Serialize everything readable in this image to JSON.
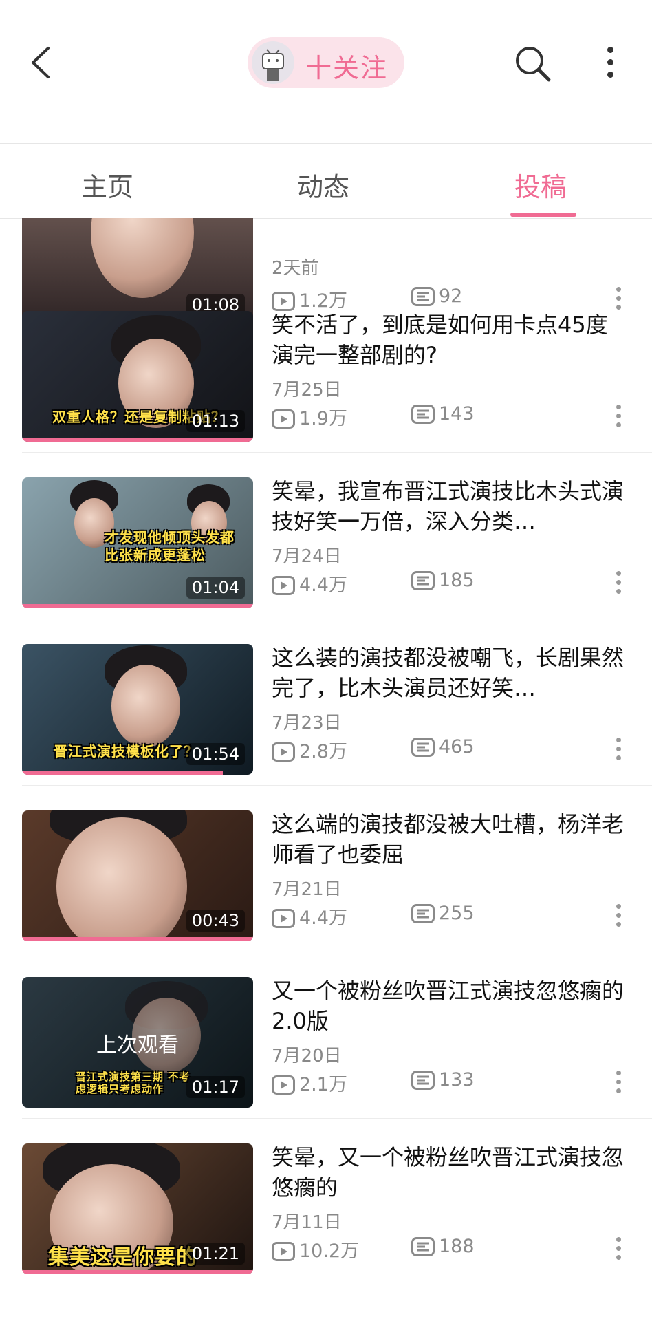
{
  "header": {
    "follow_label": "十关注",
    "colors": {
      "accent": "#f06b93",
      "pill_bg": "#fbe3ea"
    },
    "icons": [
      "back-arrow-icon",
      "tv-avatar-icon",
      "search-icon",
      "more-vertical-icon"
    ]
  },
  "tabs": [
    {
      "label": "主页",
      "active": false
    },
    {
      "label": "动态",
      "active": false
    },
    {
      "label": "投稿",
      "active": true
    }
  ],
  "videos": [
    {
      "title": "",
      "date": "2天前",
      "views": "1.2万",
      "danmaku": "92",
      "duration": "01:08",
      "progress": 1.0,
      "thumb_text": ""
    },
    {
      "title": "笑不活了，到底是如何用卡点45度演完一整部剧的?",
      "date": "7月25日",
      "views": "1.9万",
      "danmaku": "143",
      "duration": "01:13",
      "progress": 1.0,
      "thumb_text": "双重人格？还是复制粘贴？"
    },
    {
      "title": "笑晕，我宣布晋江式演技比木头式演技好笑一万倍，深入分类…",
      "date": "7月24日",
      "views": "4.4万",
      "danmaku": "185",
      "duration": "01:04",
      "progress": 1.0,
      "thumb_text": "才发现他倾顶头发都比张新成更蓬松"
    },
    {
      "title": "这么装的演技都没被嘲飞，长剧果然完了，比木头演员还好笑…",
      "date": "7月23日",
      "views": "2.8万",
      "danmaku": "465",
      "duration": "01:54",
      "progress": 0.87,
      "thumb_text": "晋江式演技模板化了？"
    },
    {
      "title": "这么端的演技都没被大吐槽，杨洋老师看了也委屈",
      "date": "7月21日",
      "views": "4.4万",
      "danmaku": "255",
      "duration": "00:43",
      "progress": 1.0,
      "thumb_text": ""
    },
    {
      "title": "又一个被粉丝吹晋江式演技忽悠瘸的2.0版",
      "date": "7月20日",
      "views": "2.1万",
      "danmaku": "133",
      "duration": "01:17",
      "progress": 0.0,
      "thumb_text": "晋江式演技第三期 不考虑逻辑只考虑动作",
      "last_watched": "上次观看"
    },
    {
      "title": "笑晕，又一个被粉丝吹晋江式演技忽悠瘸的",
      "date": "7月11日",
      "views": "10.2万",
      "danmaku": "188",
      "duration": "01:21",
      "progress": 1.0,
      "thumb_text": "集美这是你要的"
    }
  ]
}
